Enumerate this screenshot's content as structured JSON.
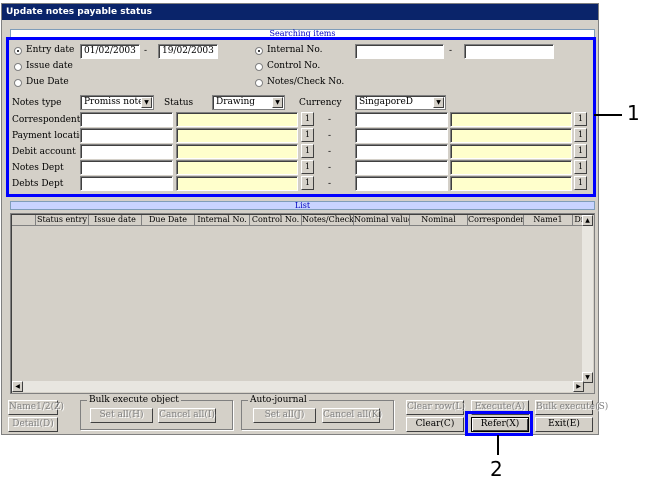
{
  "window": {
    "title": "Update notes payable status"
  },
  "search_section": {
    "title": "Searching items"
  },
  "date_options": [
    {
      "label": "Entry date",
      "selected": true
    },
    {
      "label": "Issue date",
      "selected": false
    },
    {
      "label": "Due Date",
      "selected": false
    }
  ],
  "date_from": "01/02/2003",
  "date_to": "19/02/2003",
  "number_options": [
    {
      "label": "Internal No.",
      "selected": true
    },
    {
      "label": "Control No.",
      "selected": false
    },
    {
      "label": "Notes/Check No.",
      "selected": false
    }
  ],
  "notes_type": {
    "label": "Notes type",
    "value": "Promiss notes"
  },
  "status": {
    "label": "Status",
    "value": "Drawing"
  },
  "currency": {
    "label": "Currency",
    "value": "SingaporeD"
  },
  "range_rows": [
    {
      "label": "Correspondent"
    },
    {
      "label": "Payment location"
    },
    {
      "label": "Debit account"
    },
    {
      "label": "Notes Dept"
    },
    {
      "label": "Debts Dept"
    }
  ],
  "lookup_button_label": "1",
  "dash": "-",
  "list_section": {
    "title": "List"
  },
  "columns": [
    "Status entry",
    "Issue date",
    "Due Date",
    "Internal No.",
    "Control No.",
    "Notes/Check",
    "Nominal value",
    "Nominal",
    "Corresponden",
    "Name1",
    "Dr"
  ],
  "buttons": {
    "name12": "Name1/2(Z)",
    "detail": "Detail(D)",
    "bulk_group": "Bulk execute object",
    "set_all_h": "Set all(H)",
    "cancel_all_i": "Cancel all(I)",
    "auto_group": "Auto-journal",
    "set_all_j": "Set all(J)",
    "cancel_all_k": "Cancel all(K)",
    "clear_row": "Clear row(L)",
    "execute": "Execute(A)",
    "bulk_execute": "Bulk execute(S)",
    "clear": "Clear(C)",
    "refer": "Refer(X)",
    "exit": "Exit(E)"
  },
  "callouts": {
    "one": "1",
    "two": "2"
  },
  "colors": {
    "title_bar": "#0a246a",
    "highlight": "#0000ff",
    "input_yellow": "#ffffcc"
  }
}
